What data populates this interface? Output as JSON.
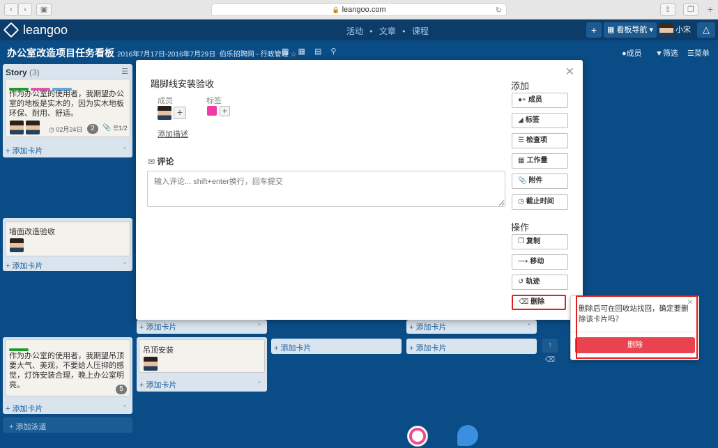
{
  "browser": {
    "url": "leangoo.com"
  },
  "app": {
    "logo": "leangoo",
    "nav": [
      "活动",
      "文章",
      "课程"
    ],
    "nav_sep": "•",
    "plus_label": "+",
    "board_nav_label": "看板导航",
    "user_name": "小宋"
  },
  "board": {
    "title": "办公室改造项目任务看板",
    "dates": "2016年7月17日-2016年7月29日",
    "org": "伯乐招聘网 - 行政管理",
    "members_label": "成员",
    "filter_label": "筛选",
    "menu_label": "菜单",
    "add_lane_label": "+ 添加泳道"
  },
  "lists": {
    "story": {
      "title": "Story",
      "count": "(3)"
    },
    "story_card": {
      "text": "作为办公室的使用者，我期望办公室的地板是实木的，因为实木地板环保、耐用、舒适。",
      "due": "02月24日",
      "comments": "2",
      "checklist": "1/2"
    },
    "wall_card": {
      "text": "墙面改造验收"
    },
    "lamp_story": {
      "text": "作为办公室的使用者，我期望吊顶要大气、美观，不要给人压抑的感觉，灯饰安装合理，晚上办公室明亮。",
      "badge": "5"
    },
    "ceiling_card": {
      "text": "吊顶安装"
    },
    "add_card_label": "+ 添加卡片"
  },
  "modal": {
    "title": "踢脚线安装验收",
    "members_label": "成员",
    "labels_label": "标签",
    "add_desc": "添加描述",
    "comment_title": "评论",
    "comment_placeholder": "输入评论... shift+enter换行，回车提交",
    "add_heading": "添加",
    "actions_heading": "操作",
    "add_buttons": [
      "成员",
      "标签",
      "检查项",
      "工作量",
      "附件",
      "截止时间"
    ],
    "action_buttons": [
      "复制",
      "移动",
      "轨迹",
      "删除"
    ],
    "label_color": "#f23aa6"
  },
  "popover": {
    "message": "删除后可在回收站找回，确定要删除该卡片吗？",
    "confirm_label": "删除"
  },
  "colors": {
    "board_bg": "#0a4d86",
    "danger": "#e8434f",
    "highlight": "#e02020",
    "label_green": "#1c9a2d",
    "label_pink": "#ea4fb4",
    "label_blue": "#5aa8e6"
  }
}
